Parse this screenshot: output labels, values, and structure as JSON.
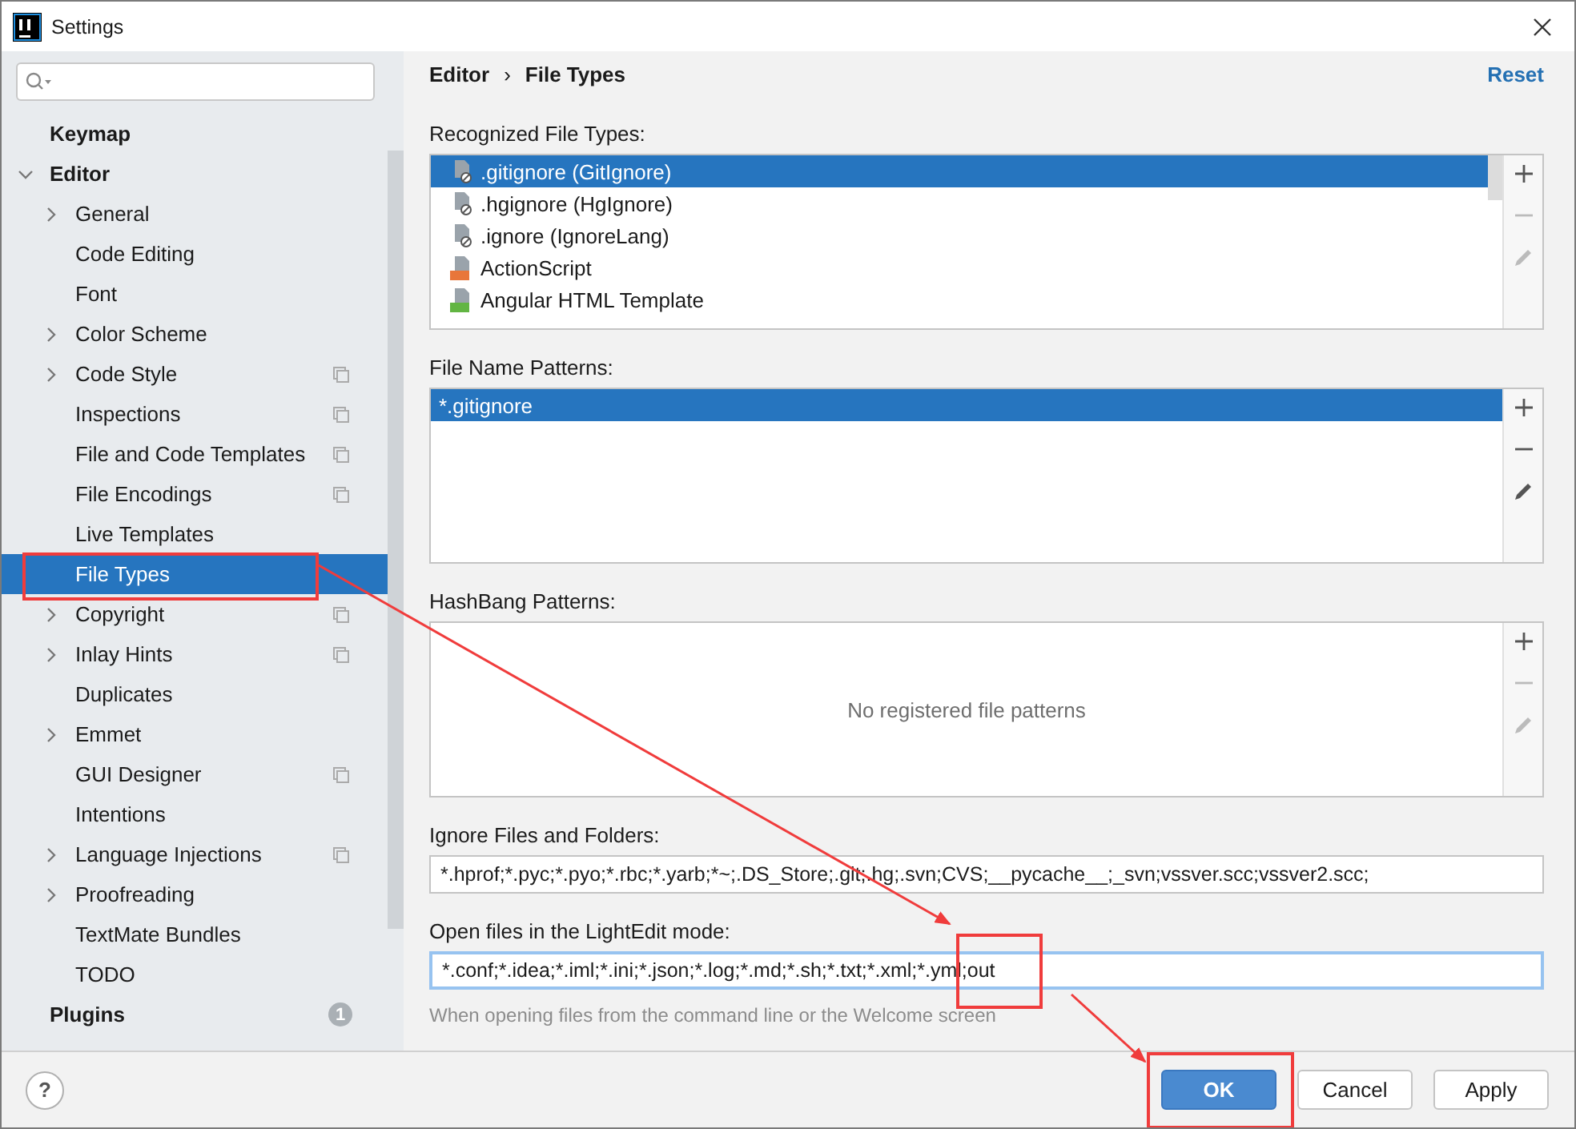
{
  "window": {
    "title": "Settings"
  },
  "sidebar": {
    "items": [
      {
        "label": "Keymap",
        "selected": false
      },
      {
        "label": "Editor",
        "selected": false,
        "expanded": true,
        "children": [
          {
            "label": "General",
            "selected": false,
            "expandable": true,
            "project_scope": false
          },
          {
            "label": "Code Editing",
            "selected": false,
            "expandable": false,
            "project_scope": false
          },
          {
            "label": "Font",
            "selected": false,
            "expandable": false,
            "project_scope": false
          },
          {
            "label": "Color Scheme",
            "selected": false,
            "expandable": true,
            "project_scope": false
          },
          {
            "label": "Code Style",
            "selected": false,
            "expandable": true,
            "project_scope": true
          },
          {
            "label": "Inspections",
            "selected": false,
            "expandable": false,
            "project_scope": true
          },
          {
            "label": "File and Code Templates",
            "selected": false,
            "expandable": false,
            "project_scope": true
          },
          {
            "label": "File Encodings",
            "selected": false,
            "expandable": false,
            "project_scope": true
          },
          {
            "label": "Live Templates",
            "selected": false,
            "expandable": false,
            "project_scope": false
          },
          {
            "label": "File Types",
            "selected": true,
            "expandable": false,
            "project_scope": false
          },
          {
            "label": "Copyright",
            "selected": false,
            "expandable": true,
            "project_scope": true
          },
          {
            "label": "Inlay Hints",
            "selected": false,
            "expandable": true,
            "project_scope": true
          },
          {
            "label": "Duplicates",
            "selected": false,
            "expandable": false,
            "project_scope": false
          },
          {
            "label": "Emmet",
            "selected": false,
            "expandable": true,
            "project_scope": false
          },
          {
            "label": "GUI Designer",
            "selected": false,
            "expandable": false,
            "project_scope": true
          },
          {
            "label": "Intentions",
            "selected": false,
            "expandable": false,
            "project_scope": false
          },
          {
            "label": "Language Injections",
            "selected": false,
            "expandable": true,
            "project_scope": true
          },
          {
            "label": "Proofreading",
            "selected": false,
            "expandable": true,
            "project_scope": false
          },
          {
            "label": "TextMate Bundles",
            "selected": false,
            "expandable": false,
            "project_scope": false
          },
          {
            "label": "TODO",
            "selected": false,
            "expandable": false,
            "project_scope": false
          }
        ]
      },
      {
        "label": "Plugins",
        "selected": false,
        "badge": "1"
      }
    ]
  },
  "breadcrumb": [
    "Editor",
    "›",
    "File Types"
  ],
  "reset": "Reset",
  "recognized_file_types": {
    "label": "Recognized File Types:",
    "rows": [
      {
        "name": ".gitignore (GitIgnore)",
        "kind": "ignore",
        "selected": true
      },
      {
        "name": ".hgignore (HgIgnore)",
        "kind": "ignore",
        "selected": false
      },
      {
        "name": ".ignore (IgnoreLang)",
        "kind": "ignore",
        "selected": false
      },
      {
        "name": "ActionScript",
        "kind": "actionscript",
        "selected": false
      },
      {
        "name": "Angular HTML Template",
        "kind": "html",
        "selected": false
      }
    ]
  },
  "file_name_patterns": {
    "label": "File Name Patterns:",
    "rows": [
      {
        "name": "*.gitignore",
        "selected": true
      }
    ]
  },
  "hashbang_patterns": {
    "label": "HashBang Patterns:",
    "empty_text": "No registered file patterns"
  },
  "ignore_files": {
    "label": "Ignore Files and Folders:",
    "value": "*.hprof;*.pyc;*.pyo;*.rbc;*.yarb;*~;.DS_Store;.git;.hg;.svn;CVS;__pycache__;_svn;vssver.scc;vssver2.scc;"
  },
  "lightedit": {
    "label": "Open files in the LightEdit mode:",
    "value": "*.conf;*.idea;*.iml;*.ini;*.json;*.log;*.md;*.sh;*.txt;*.xml;*.yml;out",
    "hint": "When opening files from the command line or the Welcome screen"
  },
  "help": "?",
  "buttons": [
    {
      "label": "OK",
      "default": true
    },
    {
      "label": "Cancel",
      "default": false
    },
    {
      "label": "Apply",
      "default": false
    }
  ]
}
